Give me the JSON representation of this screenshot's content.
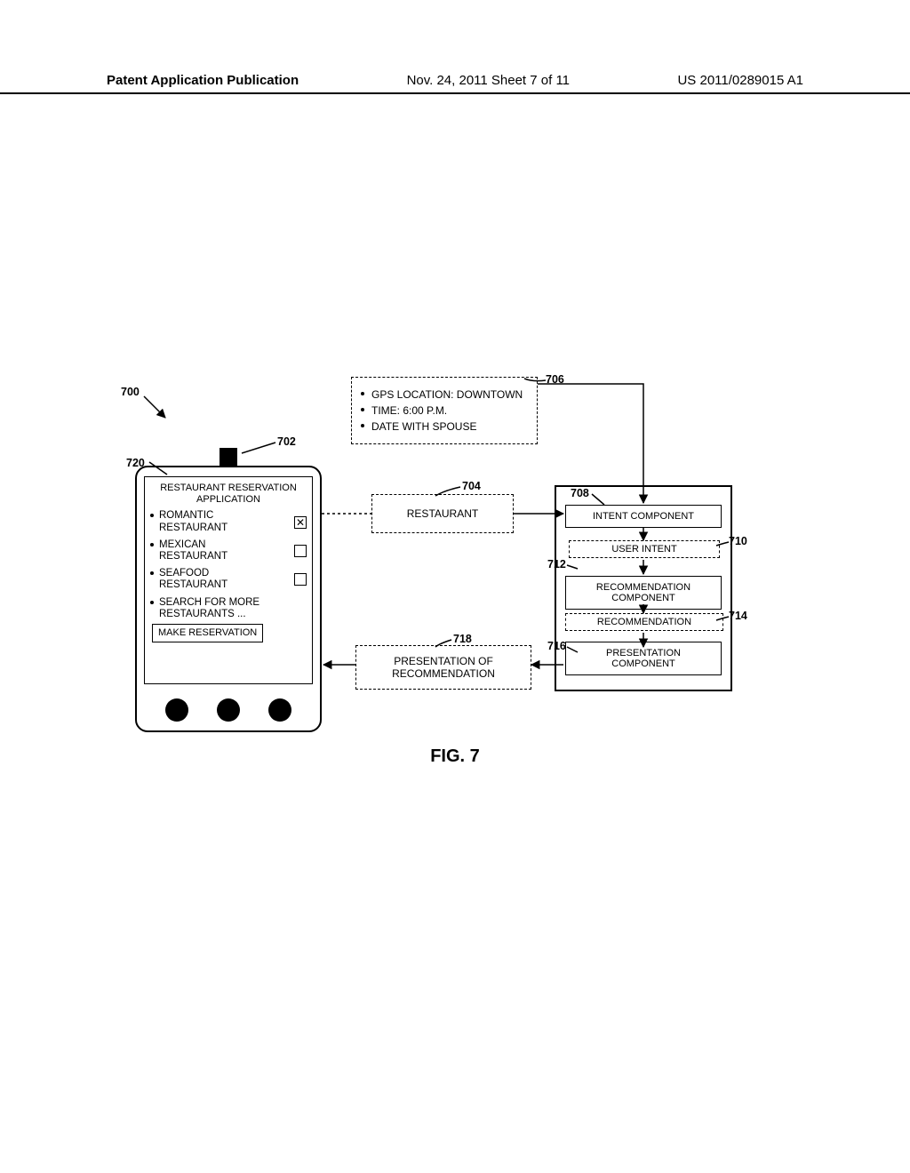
{
  "header": {
    "left": "Patent Application Publication",
    "mid": "Nov. 24, 2011  Sheet 7 of 11",
    "right": "US 2011/0289015 A1"
  },
  "figure_caption": "FIG. 7",
  "phone": {
    "app_title_line1": "RESTAURANT RESERVATION",
    "app_title_line2": "APPLICATION",
    "options": [
      {
        "label_line1": "ROMANTIC",
        "label_line2": "RESTAURANT",
        "checked": true
      },
      {
        "label_line1": "MEXICAN",
        "label_line2": "RESTAURANT",
        "checked": false
      },
      {
        "label_line1": "SEAFOOD",
        "label_line2": "RESTAURANT",
        "checked": false
      }
    ],
    "search_more_line1": "SEARCH FOR MORE",
    "search_more_line2": "RESTAURANTS ...",
    "make_reservation": "MAKE RESERVATION"
  },
  "context": {
    "items": [
      "GPS LOCATION: DOWNTOWN",
      "TIME: 6:00 P.M.",
      "DATE WITH SPOUSE"
    ]
  },
  "restaurant_label": "RESTAURANT",
  "presentation_of_rec_line1": "PRESENTATION OF",
  "presentation_of_rec_line2": "RECOMMENDATION",
  "pipeline": {
    "intent": "INTENT COMPONENT",
    "user_intent": "USER INTENT",
    "rec_comp_line1": "RECOMMENDATION",
    "rec_comp_line2": "COMPONENT",
    "recommendation": "RECOMMENDATION",
    "pres_comp_line1": "PRESENTATION",
    "pres_comp_line2": "COMPONENT"
  },
  "refs": {
    "r700": "700",
    "r702": "702",
    "r704": "704",
    "r706": "706",
    "r708": "708",
    "r710": "710",
    "r712": "712",
    "r714": "714",
    "r716": "716",
    "r718": "718",
    "r720": "720"
  }
}
